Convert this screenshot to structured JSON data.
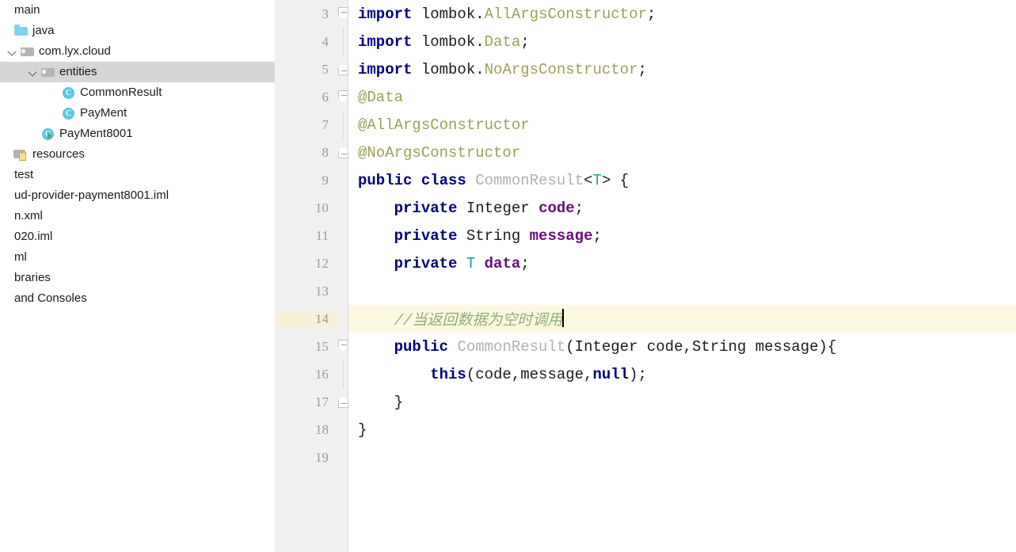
{
  "sidebar": {
    "items": [
      {
        "label": "main",
        "icon": "none",
        "indent": 0,
        "arrow": "none",
        "selected": false
      },
      {
        "label": "java",
        "icon": "folder-src",
        "indent": 0,
        "arrow": "none",
        "selected": false
      },
      {
        "label": "com.lyx.cloud",
        "icon": "folder-pkg",
        "indent": 1,
        "arrow": "expanded",
        "selected": false
      },
      {
        "label": "entities",
        "icon": "folder-pkg",
        "indent": 2,
        "arrow": "expanded",
        "selected": true
      },
      {
        "label": "CommonResult",
        "icon": "class",
        "indent": 3,
        "arrow": "none",
        "selected": false
      },
      {
        "label": "PayMent",
        "icon": "class",
        "indent": 3,
        "arrow": "none",
        "selected": false
      },
      {
        "label": "PayMent8001",
        "icon": "class-runnable",
        "indent": 2,
        "arrow": "none",
        "selected": false
      },
      {
        "label": "resources",
        "icon": "folder-res",
        "indent": 0,
        "arrow": "none",
        "selected": false
      },
      {
        "label": "test",
        "icon": "none",
        "indent": 0,
        "arrow": "none",
        "selected": false
      },
      {
        "label": "ud-provider-payment8001.iml",
        "icon": "none",
        "indent": 0,
        "arrow": "none",
        "selected": false
      },
      {
        "label": "n.xml",
        "icon": "none",
        "indent": 0,
        "arrow": "none",
        "selected": false
      },
      {
        "label": "020.iml",
        "icon": "none",
        "indent": 0,
        "arrow": "none",
        "selected": false
      },
      {
        "label": "ml",
        "icon": "none",
        "indent": 0,
        "arrow": "none",
        "selected": false
      },
      {
        "label": "braries",
        "icon": "none",
        "indent": 0,
        "arrow": "none",
        "selected": false
      },
      {
        "label": "and Consoles",
        "icon": "none",
        "indent": 0,
        "arrow": "none",
        "selected": false
      }
    ]
  },
  "editor": {
    "colors": {
      "keyword": "#000080",
      "annotation": "#9e9e5a",
      "class_name": "#b1b1b1",
      "field_name": "#660e7a",
      "generic_type": "#20999d",
      "comment": "#8fae7b",
      "line_highlight": "#fdf8e0",
      "gutter_bg": "#f0f0f0",
      "line_number": "#9b9b9b"
    },
    "lines": [
      {
        "number": "3",
        "fold": "down",
        "vline": false,
        "highlight": false,
        "tokens": [
          {
            "t": "import",
            "c": "kw"
          },
          {
            "t": " lombok.",
            "c": "plain"
          },
          {
            "t": "AllArgsConstructor",
            "c": "anno"
          },
          {
            "t": ";",
            "c": "plain"
          }
        ]
      },
      {
        "number": "4",
        "fold": "none",
        "vline": true,
        "highlight": false,
        "tokens": [
          {
            "t": "import",
            "c": "kw"
          },
          {
            "t": " lombok.",
            "c": "plain"
          },
          {
            "t": "Data",
            "c": "anno"
          },
          {
            "t": ";",
            "c": "plain"
          }
        ]
      },
      {
        "number": "5",
        "fold": "up",
        "vline": false,
        "highlight": false,
        "tokens": [
          {
            "t": "import",
            "c": "kw"
          },
          {
            "t": " lombok.",
            "c": "plain"
          },
          {
            "t": "NoArgsConstructor",
            "c": "anno"
          },
          {
            "t": ";",
            "c": "plain"
          }
        ]
      },
      {
        "number": "6",
        "fold": "down",
        "vline": false,
        "highlight": false,
        "tokens": [
          {
            "t": "@Data",
            "c": "anno"
          }
        ]
      },
      {
        "number": "7",
        "fold": "none",
        "vline": true,
        "highlight": false,
        "tokens": [
          {
            "t": "@AllArgsConstructor",
            "c": "anno"
          }
        ]
      },
      {
        "number": "8",
        "fold": "up",
        "vline": false,
        "highlight": false,
        "tokens": [
          {
            "t": "@NoArgsConstructor",
            "c": "anno"
          }
        ]
      },
      {
        "number": "9",
        "fold": "none",
        "vline": false,
        "highlight": false,
        "tokens": [
          {
            "t": "public class ",
            "c": "kw"
          },
          {
            "t": "CommonResult",
            "c": "cls"
          },
          {
            "t": "<",
            "c": "plain"
          },
          {
            "t": "T",
            "c": "generic"
          },
          {
            "t": "> {",
            "c": "plain"
          }
        ]
      },
      {
        "number": "10",
        "fold": "none",
        "vline": false,
        "highlight": false,
        "tokens": [
          {
            "t": "    ",
            "c": "plain"
          },
          {
            "t": "private",
            "c": "kw"
          },
          {
            "t": " Integer ",
            "c": "type"
          },
          {
            "t": "code",
            "c": "fieldname"
          },
          {
            "t": ";",
            "c": "plain"
          }
        ]
      },
      {
        "number": "11",
        "fold": "none",
        "vline": false,
        "highlight": false,
        "tokens": [
          {
            "t": "    ",
            "c": "plain"
          },
          {
            "t": "private",
            "c": "kw"
          },
          {
            "t": " String ",
            "c": "type"
          },
          {
            "t": "message",
            "c": "fieldname"
          },
          {
            "t": ";",
            "c": "plain"
          }
        ]
      },
      {
        "number": "12",
        "fold": "none",
        "vline": false,
        "highlight": false,
        "tokens": [
          {
            "t": "    ",
            "c": "plain"
          },
          {
            "t": "private",
            "c": "kw"
          },
          {
            "t": " ",
            "c": "plain"
          },
          {
            "t": "T",
            "c": "generic"
          },
          {
            "t": " ",
            "c": "plain"
          },
          {
            "t": "data",
            "c": "fieldname"
          },
          {
            "t": ";",
            "c": "plain"
          }
        ]
      },
      {
        "number": "13",
        "fold": "none",
        "vline": false,
        "highlight": false,
        "tokens": []
      },
      {
        "number": "14",
        "fold": "none",
        "vline": false,
        "highlight": true,
        "caret": true,
        "tokens": [
          {
            "t": "    ",
            "c": "plain"
          },
          {
            "t": "//当返回数据为空时调用",
            "c": "comment"
          }
        ]
      },
      {
        "number": "15",
        "fold": "down",
        "vline": false,
        "highlight": false,
        "tokens": [
          {
            "t": "    ",
            "c": "plain"
          },
          {
            "t": "public ",
            "c": "kw"
          },
          {
            "t": "CommonResult",
            "c": "cls"
          },
          {
            "t": "(Integer code,String message){",
            "c": "plain"
          }
        ]
      },
      {
        "number": "16",
        "fold": "none",
        "vline": true,
        "highlight": false,
        "tokens": [
          {
            "t": "        ",
            "c": "plain"
          },
          {
            "t": "this",
            "c": "kw"
          },
          {
            "t": "(code,message,",
            "c": "plain"
          },
          {
            "t": "null",
            "c": "kw"
          },
          {
            "t": ");",
            "c": "plain"
          }
        ]
      },
      {
        "number": "17",
        "fold": "up",
        "vline": false,
        "highlight": false,
        "tokens": [
          {
            "t": "    }",
            "c": "plain"
          }
        ]
      },
      {
        "number": "18",
        "fold": "none",
        "vline": false,
        "highlight": false,
        "tokens": [
          {
            "t": "}",
            "c": "plain"
          }
        ]
      },
      {
        "number": "19",
        "fold": "none",
        "vline": false,
        "highlight": false,
        "tokens": []
      }
    ]
  }
}
